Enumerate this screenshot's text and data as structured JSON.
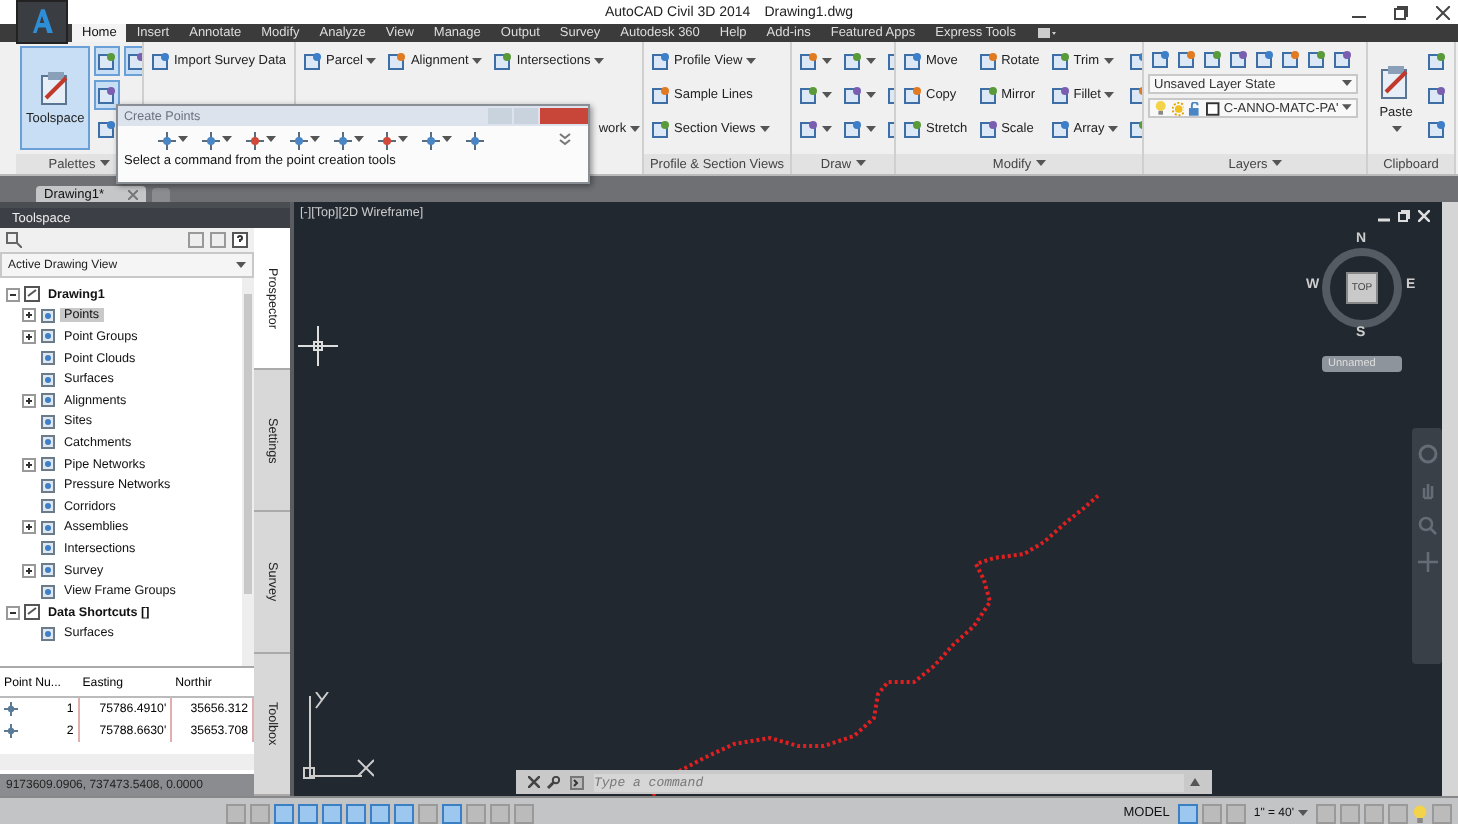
{
  "window": {
    "app_name": "AutoCAD Civil 3D 2014",
    "document": "Drawing1.dwg"
  },
  "ribbon_tabs": [
    {
      "label": "Home",
      "selected": true
    },
    {
      "label": "Insert",
      "selected": false
    },
    {
      "label": "Annotate",
      "selected": false
    },
    {
      "label": "Modify",
      "selected": false
    },
    {
      "label": "Analyze",
      "selected": false
    },
    {
      "label": "View",
      "selected": false
    },
    {
      "label": "Manage",
      "selected": false
    },
    {
      "label": "Output",
      "selected": false
    },
    {
      "label": "Survey",
      "selected": false
    },
    {
      "label": "Autodesk 360",
      "selected": false
    },
    {
      "label": "Help",
      "selected": false
    },
    {
      "label": "Add-ins",
      "selected": false
    },
    {
      "label": "Featured Apps",
      "selected": false
    },
    {
      "label": "Express Tools",
      "selected": false
    }
  ],
  "ribbon_panels": [
    {
      "title": "Palettes",
      "title_menu": true,
      "columns": [
        [
          {
            "kind": "large",
            "label": "Toolspace",
            "selected": true
          }
        ],
        [
          {
            "kind": "icon",
            "selected": true
          },
          {
            "kind": "icon",
            "selected": true
          },
          {
            "kind": "icon",
            "selected": false
          }
        ],
        [
          {
            "kind": "icon",
            "selected": true
          }
        ]
      ]
    },
    {
      "columns": [
        [
          {
            "kind": "small",
            "label": "Import Survey Data"
          }
        ]
      ]
    },
    {
      "columns": [
        [
          {
            "kind": "small",
            "label": "Parcel",
            "dropdown": true
          }
        ],
        [
          {
            "kind": "small",
            "label": "Alignment",
            "dropdown": true
          }
        ],
        [
          {
            "kind": "small",
            "label": "Intersections",
            "dropdown": true
          },
          {
            "kind": "partial",
            "label": "work",
            "dropdown": true
          }
        ]
      ]
    },
    {
      "title": "Profile & Section Views",
      "columns": [
        [
          {
            "kind": "small",
            "label": "Profile View",
            "dropdown": true
          },
          {
            "kind": "small",
            "label": "Sample Lines"
          },
          {
            "kind": "small",
            "label": "Section Views",
            "dropdown": true
          }
        ]
      ]
    },
    {
      "title": "Draw",
      "title_menu": true,
      "columns": [
        [
          {
            "kind": "icon",
            "dropdown": true
          },
          {
            "kind": "icon",
            "dropdown": true
          },
          {
            "kind": "icon",
            "dropdown": true
          }
        ],
        [
          {
            "kind": "icon",
            "dropdown": true
          },
          {
            "kind": "icon",
            "dropdown": true
          },
          {
            "kind": "icon",
            "dropdown": true
          }
        ],
        [
          {
            "kind": "icon"
          },
          {
            "kind": "icon"
          },
          {
            "kind": "icon"
          }
        ]
      ]
    },
    {
      "title": "Modify",
      "title_menu": true,
      "columns": [
        [
          {
            "kind": "small",
            "label": "Move"
          },
          {
            "kind": "small",
            "label": "Copy"
          },
          {
            "kind": "small",
            "label": "Stretch"
          }
        ],
        [
          {
            "kind": "small",
            "label": "Rotate"
          },
          {
            "kind": "small",
            "label": "Mirror"
          },
          {
            "kind": "small",
            "label": "Scale"
          }
        ],
        [
          {
            "kind": "small",
            "label": "Trim",
            "dropdown": true
          },
          {
            "kind": "small",
            "label": "Fillet",
            "dropdown": true
          },
          {
            "kind": "small",
            "label": "Array",
            "dropdown": true
          }
        ],
        [
          {
            "kind": "icon"
          },
          {
            "kind": "icon"
          },
          {
            "kind": "icon"
          }
        ]
      ]
    },
    {
      "title": "Layers",
      "title_menu": true,
      "columns": [
        [
          {
            "kind": "icons"
          },
          {
            "kind": "combo",
            "label": "Unsaved Layer State"
          },
          {
            "kind": "layer",
            "label": "C-ANNO-MATC-PA'"
          }
        ]
      ]
    },
    {
      "title": "Clipboard",
      "columns": [
        [
          {
            "kind": "large",
            "label": "Paste",
            "dropdown": true
          }
        ],
        [
          {
            "kind": "icon"
          },
          {
            "kind": "icon"
          },
          {
            "kind": "icon"
          }
        ]
      ]
    }
  ],
  "popup": {
    "title": "Create Points",
    "hint": "Select a command from the point creation tools"
  },
  "doc_tabs": [
    {
      "label": "Drawing1*",
      "selected": true
    }
  ],
  "toolspace": {
    "title": "Toolspace",
    "view_selector": "Active Drawing View",
    "tree": [
      {
        "label": "Drawing1",
        "selected": false,
        "expanded": true,
        "children": [
          {
            "label": "Points",
            "selected": true,
            "expanded": false
          },
          {
            "label": "Point Groups",
            "selected": false,
            "expanded": false
          },
          {
            "label": "Point Clouds",
            "selected": false
          },
          {
            "label": "Surfaces",
            "selected": false
          },
          {
            "label": "Alignments",
            "selected": false,
            "expanded": false
          },
          {
            "label": "Sites",
            "selected": false
          },
          {
            "label": "Catchments",
            "selected": false
          },
          {
            "label": "Pipe Networks",
            "selected": false,
            "expanded": false
          },
          {
            "label": "Pressure Networks",
            "selected": false
          },
          {
            "label": "Corridors",
            "selected": false
          },
          {
            "label": "Assemblies",
            "selected": false,
            "expanded": false
          },
          {
            "label": "Intersections",
            "selected": false
          },
          {
            "label": "Survey",
            "selected": false,
            "expanded": false
          },
          {
            "label": "View Frame Groups",
            "selected": false
          }
        ]
      },
      {
        "label": "Data Shortcuts []",
        "selected": false,
        "expanded": true,
        "children": [
          {
            "label": "Surfaces",
            "selected": false
          }
        ]
      }
    ],
    "side_tabs": [
      {
        "label": "Prospector",
        "selected": true
      },
      {
        "label": "Settings",
        "selected": false
      },
      {
        "label": "Survey",
        "selected": false
      },
      {
        "label": "Toolbox",
        "selected": false
      }
    ],
    "table": {
      "columns": [
        "Point Nu...",
        "Easting",
        "Northir"
      ],
      "rows": [
        [
          "1",
          "75786.4910'",
          "35656.312"
        ],
        [
          "2",
          "75788.6630'",
          "35653.708"
        ]
      ]
    }
  },
  "viewport": {
    "label": "[-][Top][2D Wireframe]",
    "viewcube": {
      "north": "N",
      "east": "E",
      "south": "S",
      "west": "W",
      "face": "TOP",
      "view_name": "Unnamed"
    },
    "command_line": {
      "placeholder": "Type a command"
    }
  },
  "status_bar": {
    "coordinates": "9173609.0906, 737473.5408, 0.0000",
    "space": "MODEL",
    "annotation_scale": "1\" = 40'",
    "toggles": [
      {
        "on": false
      },
      {
        "on": false
      },
      {
        "on": true
      },
      {
        "on": true
      },
      {
        "on": true
      },
      {
        "on": true
      },
      {
        "on": true
      },
      {
        "on": true
      },
      {
        "on": false
      },
      {
        "on": true
      },
      {
        "on": false
      },
      {
        "on": false
      },
      {
        "on": false
      }
    ]
  }
}
